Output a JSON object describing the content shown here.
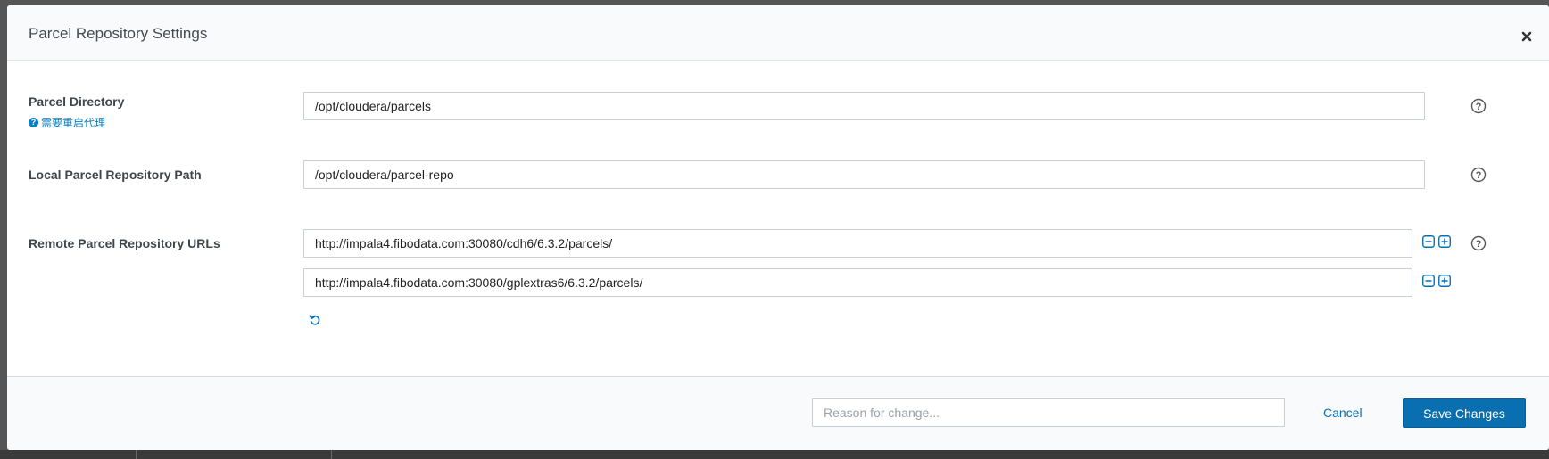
{
  "modal": {
    "title": "Parcel Repository Settings",
    "close_icon": "close-icon"
  },
  "fields": {
    "parcel_directory": {
      "label": "Parcel Directory",
      "note": "需要重启代理",
      "value": "/opt/cloudera/parcels"
    },
    "local_repo_path": {
      "label": "Local Parcel Repository Path",
      "value": "/opt/cloudera/parcel-repo"
    },
    "remote_repo_urls": {
      "label": "Remote Parcel Repository URLs",
      "values": [
        "http://impala4.fibodata.com:30080/cdh6/6.3.2/parcels/",
        "http://impala4.fibodata.com:30080/gplextras6/6.3.2/parcels/"
      ]
    }
  },
  "footer": {
    "reason_placeholder": "Reason for change...",
    "cancel_label": "Cancel",
    "save_label": "Save Changes"
  },
  "colors": {
    "accent": "#0a6fb0",
    "link": "#0a7fc1"
  }
}
